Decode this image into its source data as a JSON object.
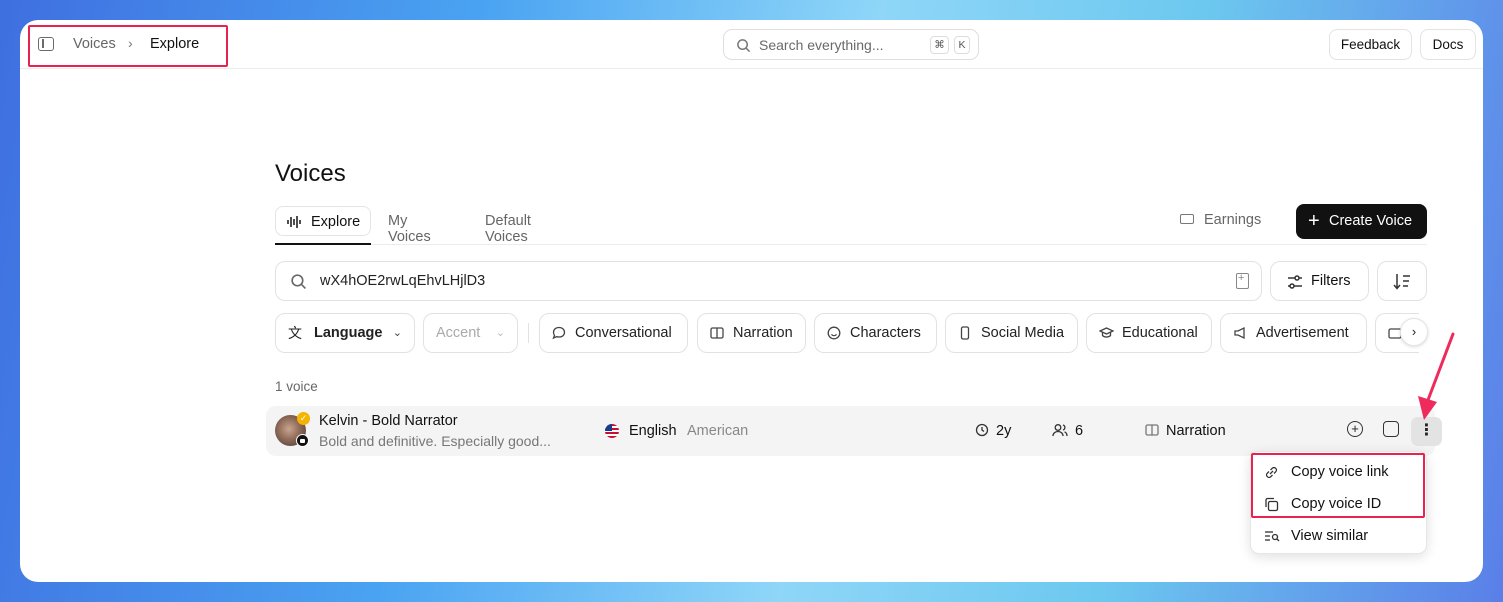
{
  "topbar": {
    "breadcrumb": [
      "Voices",
      "Explore"
    ],
    "breadcrumb_sep": "›",
    "search_placeholder": "Search everything...",
    "shortcut_cmd": "⌘",
    "shortcut_key": "K",
    "feedback_label": "Feedback",
    "docs_label": "Docs"
  },
  "page": {
    "title": "Voices",
    "tabs": [
      {
        "label": "Explore",
        "active": true
      },
      {
        "label": "My Voices",
        "active": false
      },
      {
        "label": "Default Voices",
        "active": false
      }
    ],
    "earnings_label": "Earnings",
    "create_label": "Create Voice"
  },
  "search": {
    "value": "wX4hOE2rwLqEhvLHjlD3",
    "filters_label": "Filters"
  },
  "chips": {
    "language": "Language",
    "accent": "Accent",
    "categories": [
      "Conversational",
      "Narration",
      "Characters",
      "Social Media",
      "Educational",
      "Advertisement"
    ]
  },
  "results": {
    "count": "1 voice",
    "voices": [
      {
        "name": "Kelvin - Bold Narrator",
        "description": "Bold and definitive. Especially good...",
        "language": "English",
        "accent": "American",
        "age": "2y",
        "users": "6",
        "category": "Narration"
      }
    ]
  },
  "menu": {
    "items": [
      "Copy voice link",
      "Copy voice ID",
      "View similar"
    ]
  },
  "colors": {
    "highlight": "#e8234f",
    "primary_button": "#111111",
    "row_background": "#f4f4f4"
  }
}
